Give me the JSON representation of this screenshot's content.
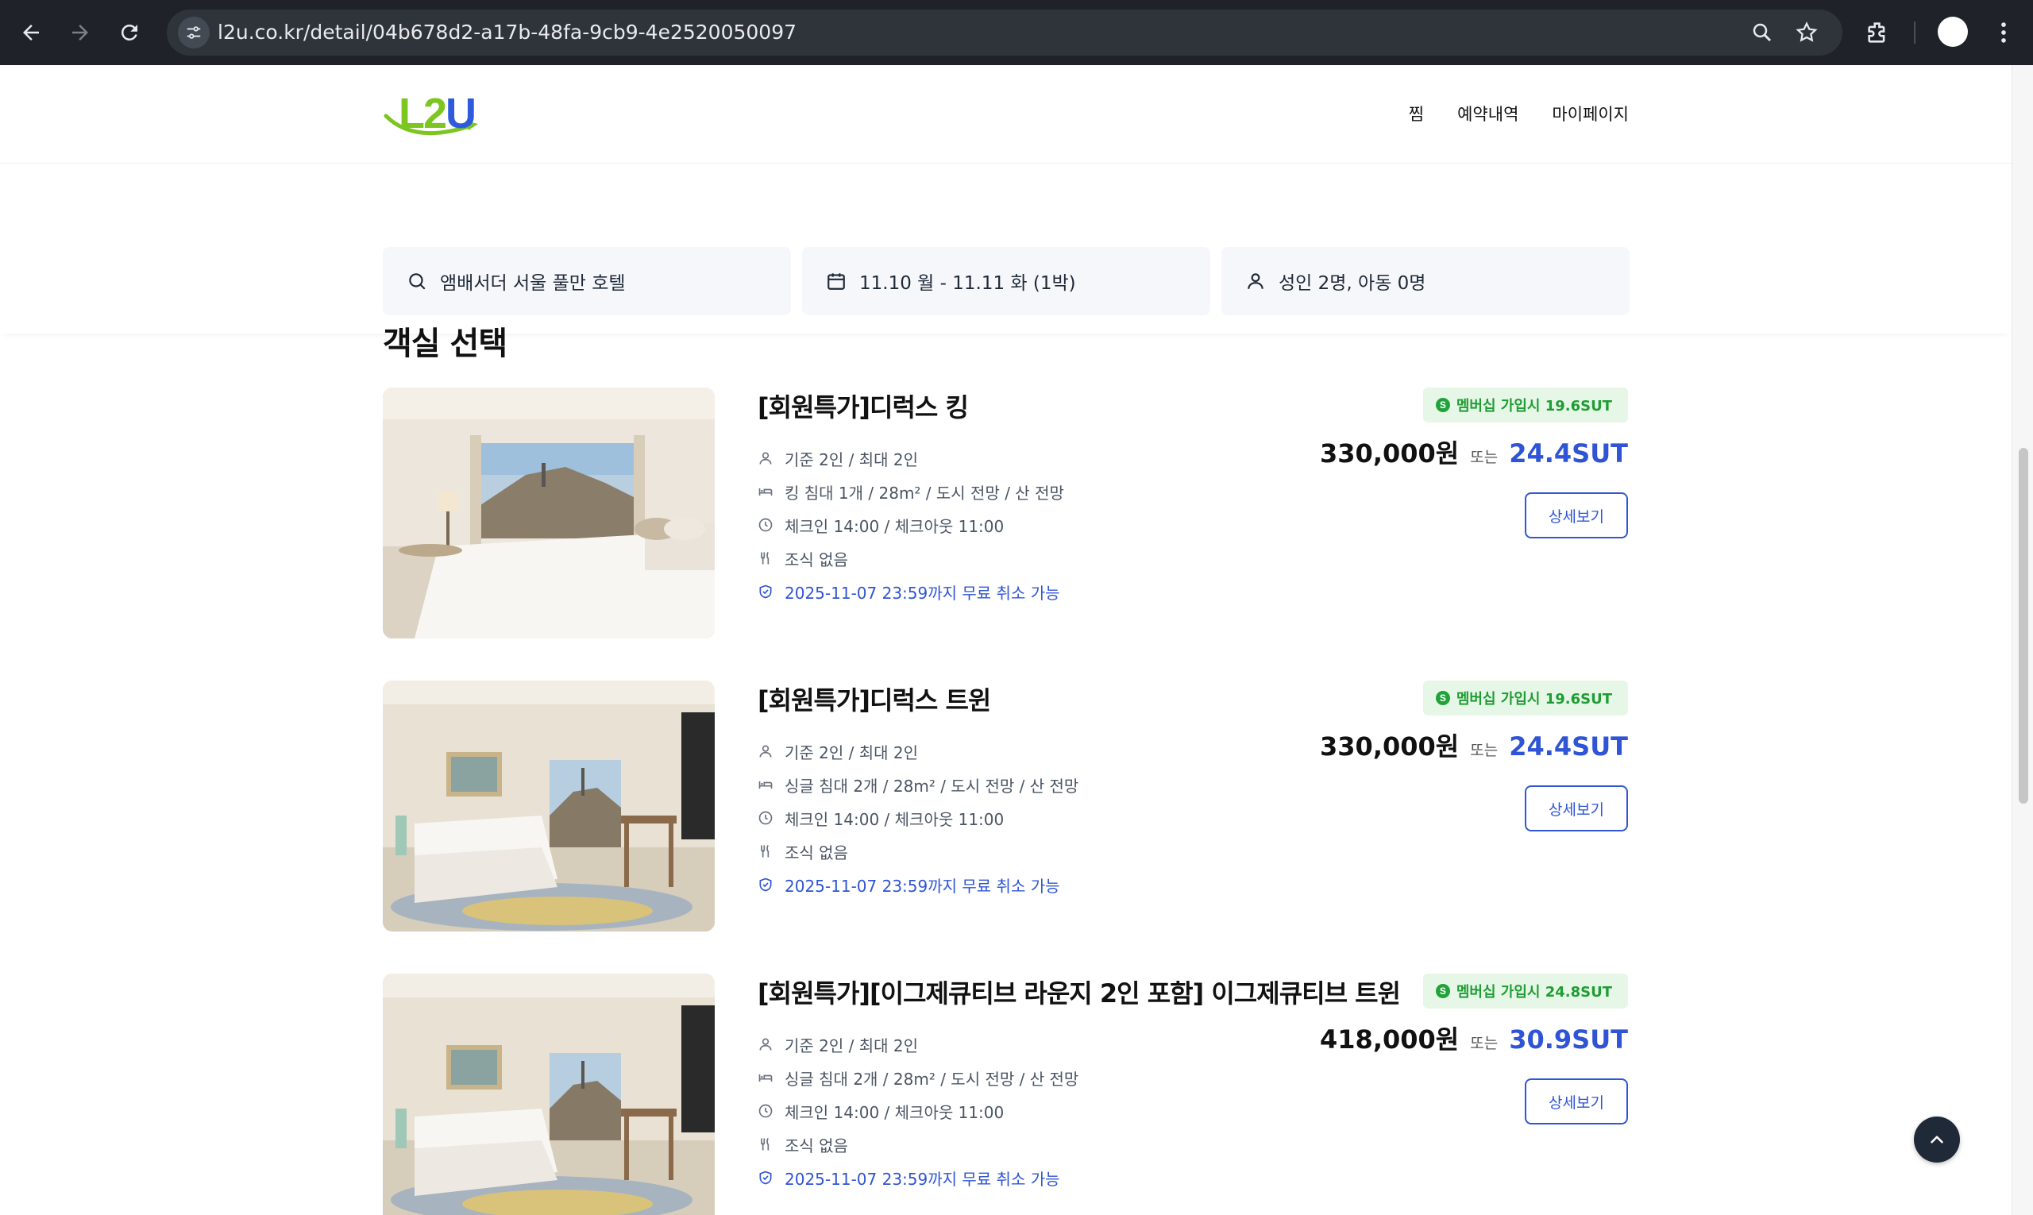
{
  "browser": {
    "url": "l2u.co.kr/detail/04b678d2-a17b-48fa-9cb9-4e2520050097"
  },
  "header": {
    "logo_text": "L2U",
    "nav": [
      "찜",
      "예약내역",
      "마이페이지"
    ]
  },
  "search": {
    "hotel": "앰배서더 서울 풀만 호텔",
    "dates": "11.10 월 - 11.11 화 (1박)",
    "guests": "성인 2명, 아동 0명"
  },
  "section_title": "객실 선택",
  "rooms": [
    {
      "name": "[회원특가]디럭스 킹",
      "occupancy": "기준 2인 / 최대 2인",
      "bed": "킹 침대 1개 / 28m² / 도시 전망 / 산 전망",
      "checkin": "체크인 14:00 / 체크아웃 11:00",
      "breakfast": "조식 없음",
      "cancel": "2025-11-07 23:59까지 무료 취소 가능",
      "badge": "멤버십 가입시 19.6SUT",
      "price": "330,000원",
      "or": "또는",
      "sut": "24.4SUT",
      "button": "상세보기"
    },
    {
      "name": "[회원특가]디럭스 트윈",
      "occupancy": "기준 2인 / 최대 2인",
      "bed": "싱글 침대 2개 / 28m² / 도시 전망 / 산 전망",
      "checkin": "체크인 14:00 / 체크아웃 11:00",
      "breakfast": "조식 없음",
      "cancel": "2025-11-07 23:59까지 무료 취소 가능",
      "badge": "멤버십 가입시 19.6SUT",
      "price": "330,000원",
      "or": "또는",
      "sut": "24.4SUT",
      "button": "상세보기"
    },
    {
      "name": "[회원특가][이그제큐티브 라운지 2인 포함] 이그제큐티브 트윈",
      "occupancy": "기준 2인 / 최대 2인",
      "bed": "싱글 침대 2개 / 28m² / 도시 전망 / 산 전망",
      "checkin": "체크인 14:00 / 체크아웃 11:00",
      "breakfast": "조식 없음",
      "cancel": "2025-11-07 23:59까지 무료 취소 가능",
      "badge": "멤버십 가입시 24.8SUT",
      "price": "418,000원",
      "or": "또는",
      "sut": "30.9SUT",
      "button": "상세보기"
    }
  ],
  "colors": {
    "accent_blue": "#2f54d6",
    "badge_green": "#1f9d34",
    "logo_green": "#7cc61f"
  }
}
